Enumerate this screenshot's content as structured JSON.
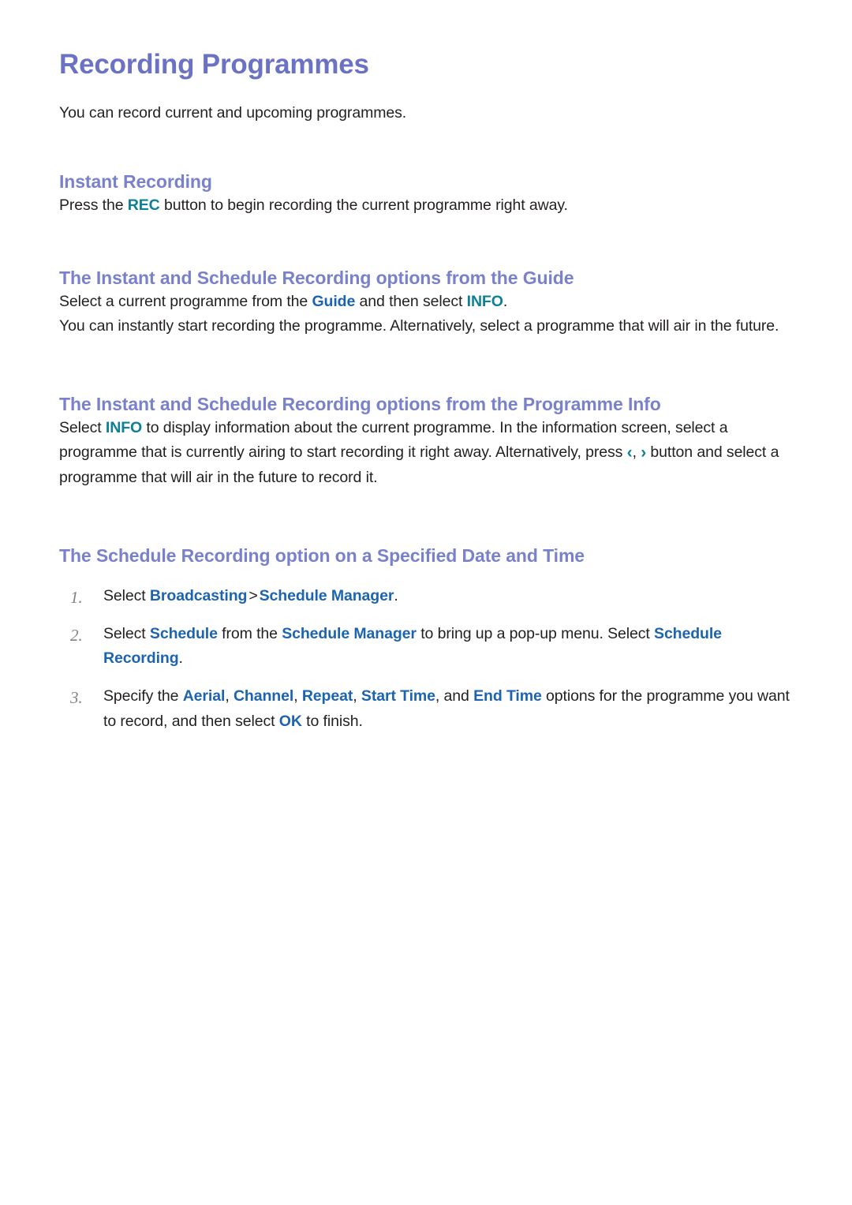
{
  "page": {
    "title": "Recording Programmes",
    "lead": "You can record current and upcoming programmes."
  },
  "sections": [
    {
      "id": "instant-recording",
      "heading": "Instant Recording",
      "paragraph_parts": {
        "before": "Press the ",
        "token": "REC",
        "after": " button to begin recording the current programme right away."
      }
    },
    {
      "id": "guide-options",
      "heading": "The Instant and Schedule Recording options from the Guide",
      "p1": {
        "a": "Select a current programme from the ",
        "t1": "Guide",
        "b": " and then select ",
        "t2": "INFO",
        "c": "."
      },
      "p2": "You can instantly start recording the programme. Alternatively, select a programme that will air in the future."
    },
    {
      "id": "programme-info-options",
      "heading": "The Instant and Schedule Recording options from the Programme Info",
      "p1": {
        "a": "Select ",
        "t1": "INFO",
        "b": " to display information about the current programme. In the information screen, select a programme that is currently airing to start recording it right away. Alternatively, press ",
        "chev_left": "‹",
        "chev_comma": ", ",
        "chev_right": "›",
        "c": " button and select a programme that will air in the future to record it."
      }
    },
    {
      "id": "schedule-date-time",
      "heading": "The Schedule Recording option on a Specified Date and Time",
      "steps": [
        {
          "num": "1.",
          "a": "Select ",
          "t1": "Broadcasting",
          "sep": ">",
          "t2": "Schedule Manager",
          "b": "."
        },
        {
          "num": "2.",
          "a": "Select ",
          "t1": "Schedule",
          "b": " from the ",
          "t2": "Schedule Manager",
          "c": " to bring up a pop-up menu. Select ",
          "t3": "Schedule Recording",
          "d": "."
        },
        {
          "num": "3.",
          "a": "Specify the ",
          "t1": "Aerial",
          "b": ", ",
          "t2": "Channel",
          "c": ", ",
          "t3": "Repeat",
          "d": ", ",
          "t4": "Start Time",
          "e": ", and ",
          "t5": "End Time",
          "f": " options for the programme you want to record, and then select ",
          "t6": "OK",
          "g": " to finish."
        }
      ]
    }
  ],
  "colors": {
    "title": "#6b72c4",
    "heading": "#7a81cb",
    "link_blue": "#1c64b0",
    "link_teal": "#0d7f96",
    "body_text": "#231f20",
    "step_number": "#808284",
    "background": "#ffffff"
  }
}
